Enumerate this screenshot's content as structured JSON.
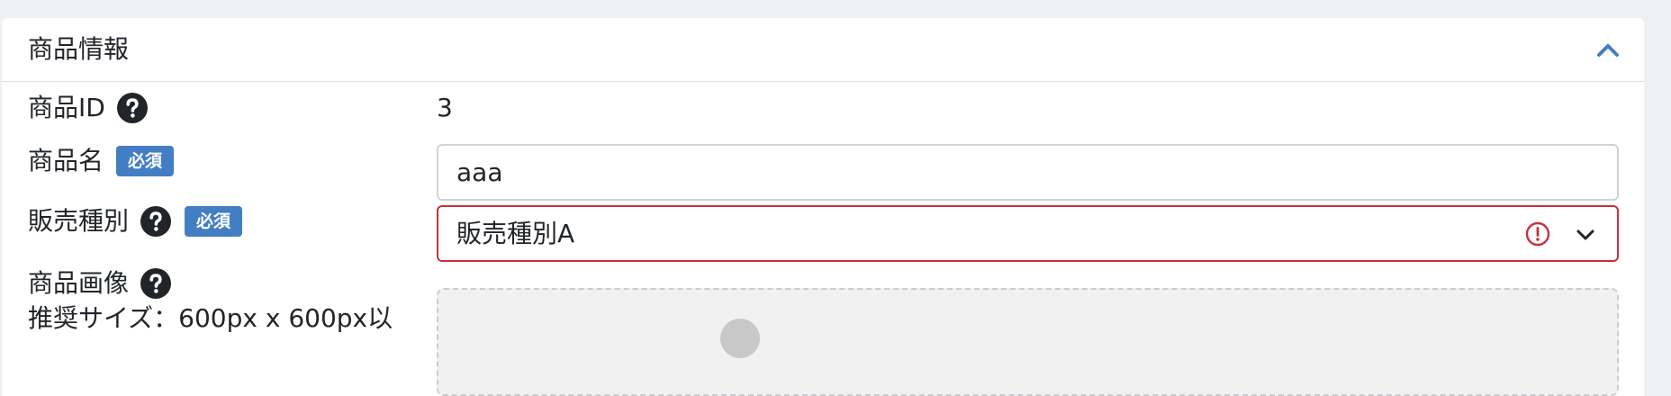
{
  "panel": {
    "title": "商品情報",
    "collapse_icon": "chevron-up-icon",
    "accent_color": "#437ec4"
  },
  "fields": {
    "product_id": {
      "label": "商品ID",
      "value": "3",
      "help_icon": "question-circle-icon"
    },
    "product_name": {
      "label": "商品名",
      "required_badge": "必須",
      "value": "aaa"
    },
    "sale_type": {
      "label": "販売種別",
      "required_badge": "必須",
      "selected": "販売種別A",
      "invalid_icon": "exclamation-circle-icon",
      "dropdown_icon": "chevron-down-icon",
      "error_color": "#c8303c"
    },
    "product_image": {
      "label": "商品画像",
      "recommended_size": "推奨サイズ：600px x 600px以"
    }
  }
}
